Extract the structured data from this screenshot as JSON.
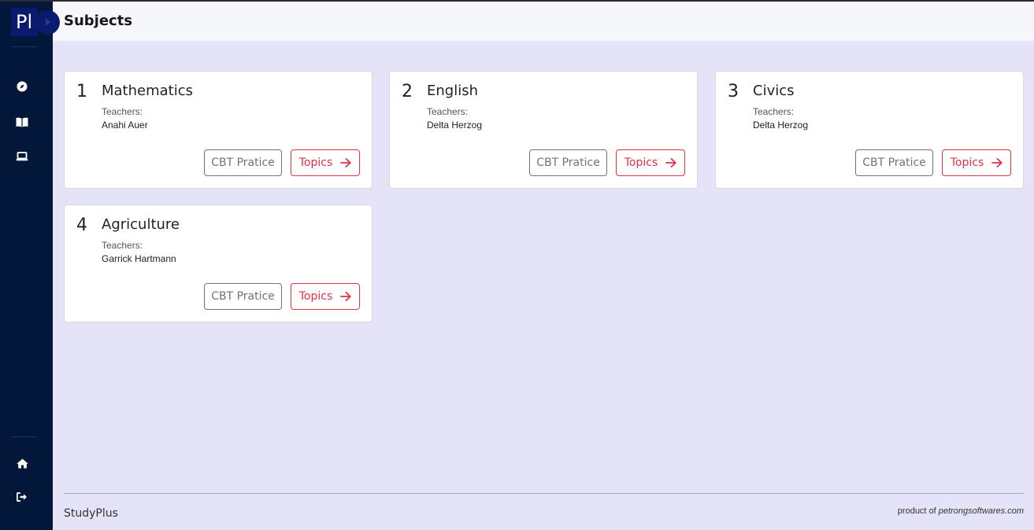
{
  "app": {
    "logo_text": "Pl",
    "page_title": "Subjects"
  },
  "sidebar": {
    "top_items": [
      {
        "icon": "compass-icon"
      },
      {
        "icon": "book-icon"
      },
      {
        "icon": "laptop-icon"
      }
    ],
    "bottom_items": [
      {
        "icon": "home-icon"
      },
      {
        "icon": "logout-icon"
      }
    ]
  },
  "subjects": [
    {
      "number": "1",
      "name": "Mathematics",
      "teachers_label": "Teachers:",
      "teacher": "Anahi Auer",
      "cbt_label": "CBT Pratice",
      "topics_label": "Topics"
    },
    {
      "number": "2",
      "name": "English",
      "teachers_label": "Teachers:",
      "teacher": "Delta Herzog",
      "cbt_label": "CBT Pratice",
      "topics_label": "Topics"
    },
    {
      "number": "3",
      "name": "Civics",
      "teachers_label": "Teachers:",
      "teacher": "Delta Herzog",
      "cbt_label": "CBT Pratice",
      "topics_label": "Topics"
    },
    {
      "number": "4",
      "name": "Agriculture",
      "teachers_label": "Teachers:",
      "teacher": "Garrick Hartmann",
      "cbt_label": "CBT Pratice",
      "topics_label": "Topics"
    }
  ],
  "footer": {
    "brand": "StudyPlus",
    "credit_prefix": "product of",
    "credit_link": "petrongsoftwares.com"
  },
  "colors": {
    "sidebar_bg": "#02173a",
    "page_bg": "#e5e3f7",
    "topbar_bg": "#f6f7fb",
    "topics_accent": "#dc3545",
    "cbt_outline": "#6c757d"
  }
}
